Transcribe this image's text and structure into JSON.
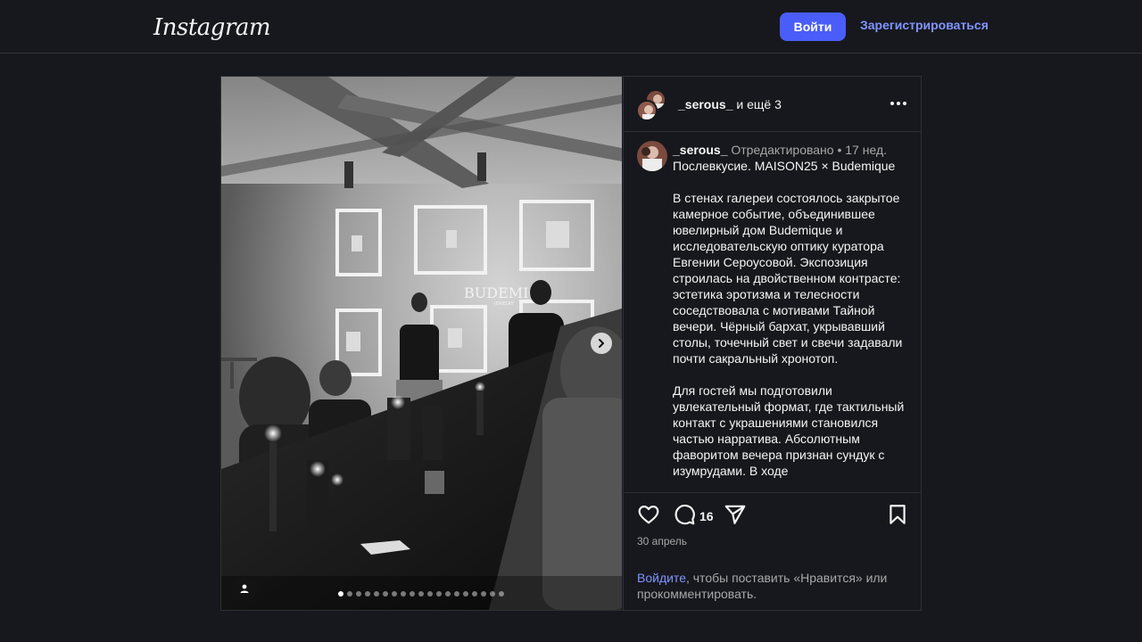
{
  "nav": {
    "logo": "Instagram",
    "login_label": "Войти",
    "signup_label": "Зарегистрироваться"
  },
  "post": {
    "header": {
      "username": "_serous_",
      "coauthors_suffix": " и ещё 3"
    },
    "caption": {
      "username": "_serous_",
      "edited_label": "Отредактировано",
      "separator": "•",
      "time_ago": "17 нед.",
      "title_line": "Послевкусие. MAISON25 × Budemique",
      "para1": "В стенах галереи состоялось закрытое камерное событие, объединившее ювелирный дом Budemique и исследовательскую оптику куратора Евгении Сероусовой. Экспозиция строилась на двойственном контрасте: эстетика эротизма и телесности соседствовала с мотивами Тайной вечери. Чёрный бархат, укрывавший столы, точечный свет и свечи задавали почти сакральный хронотоп.",
      "para2": "Для гостей мы подготовили увлекательный формат, где тактильный контакт с украшениями становился частью нарратива. Абсолютным фаворитом вечера признан сундук с изумрудами. В ходе"
    },
    "image": {
      "projection_brand": "BUDEMIQ",
      "projection_sub": "JEWELRY",
      "slide_count": 19,
      "active_slide": 1
    },
    "comments_count": "16",
    "date": "30 апрель",
    "login_prompt": {
      "link": "Войдите",
      "rest": ", чтобы поставить «Нравится» или прокомментировать."
    }
  },
  "icons": {
    "more": "more-horizontal-icon",
    "like": "heart-icon",
    "comment": "comment-icon",
    "share": "paper-plane-icon",
    "save": "bookmark-icon",
    "next": "chevron-right-icon",
    "tag": "user-tag-icon"
  },
  "colors": {
    "background": "#17181d",
    "accent": "#4a5df9",
    "link": "#7f94ff",
    "muted": "#a8a8a8"
  }
}
